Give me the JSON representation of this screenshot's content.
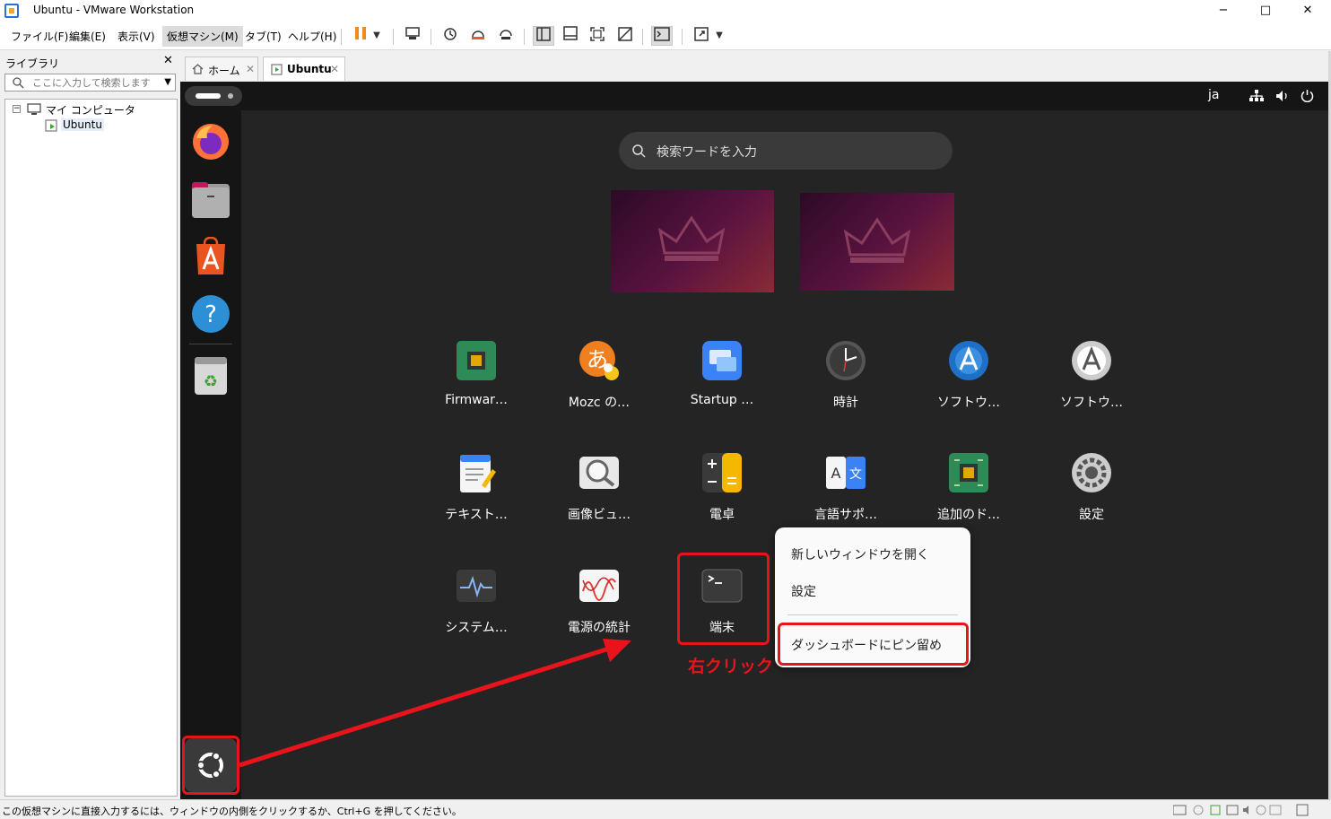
{
  "window": {
    "title": "Ubuntu - VMware Workstation",
    "minimize": "−",
    "maximize": "□",
    "close": "✕"
  },
  "menubar": {
    "items": [
      "ファイル(F)",
      "編集(E)",
      "表示(V)",
      "仮想マシン(M)",
      "タブ(T)",
      "ヘルプ(H)"
    ]
  },
  "library": {
    "header": "ライブラリ",
    "close": "✕",
    "search_placeholder": "ここに入力して検索します",
    "tree_root": "マイ コンピュータ",
    "tree_child": "Ubuntu"
  },
  "tabs": [
    {
      "label": "ホーム",
      "close": "✕"
    },
    {
      "label": "Ubuntu",
      "close": "✕"
    }
  ],
  "topbar": {
    "lang": "ja"
  },
  "overview": {
    "search_placeholder": "検索ワードを入力",
    "apps_row1": [
      "Firmwar…",
      "Mozc の…",
      "Startup …",
      "時計",
      "ソフトウ…",
      "ソフトウ…"
    ],
    "apps_row2": [
      "テキスト…",
      "画像ビュ…",
      "電卓",
      "言語サポ…",
      "追加のド…",
      "設定"
    ],
    "apps_row3": [
      "システム…",
      "電源の統計",
      "端末"
    ]
  },
  "context_menu": {
    "new_window": "新しいウィンドウを開く",
    "settings": "設定",
    "pin": "ダッシュボードにピン留め"
  },
  "annotation": {
    "right_click": "右クリック"
  },
  "statusbar": {
    "text": "この仮想マシンに直接入力するには、ウィンドウの内側をクリックするか、Ctrl+G を押してください。"
  },
  "colors": {
    "annotation_red": "#e8141c",
    "ubuntu_orange": "#e95420",
    "vm_bg": "#242424"
  }
}
